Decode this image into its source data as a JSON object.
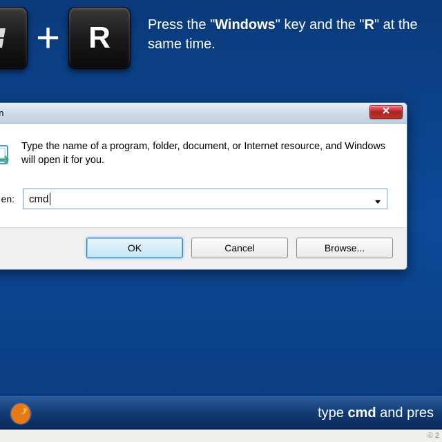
{
  "instruction": {
    "prefix": "Press the \"",
    "key1": "Windows",
    "mid": "\" key and the \"",
    "key2": "R",
    "suffix": "\" at the same time."
  },
  "keys": {
    "plus": "+",
    "r_label": "R"
  },
  "dialog": {
    "title": "un",
    "description": "Type the name of a program, folder, document, or Internet resource, and Windows will open it for you.",
    "open_label": "en:",
    "open_value": "cmd",
    "buttons": {
      "ok": "OK",
      "cancel": "Cancel",
      "browse": "Browse..."
    }
  },
  "taskbar": {
    "prefix": "type ",
    "bold": "cmd",
    "suffix": " and pres"
  },
  "footer": "© 2"
}
